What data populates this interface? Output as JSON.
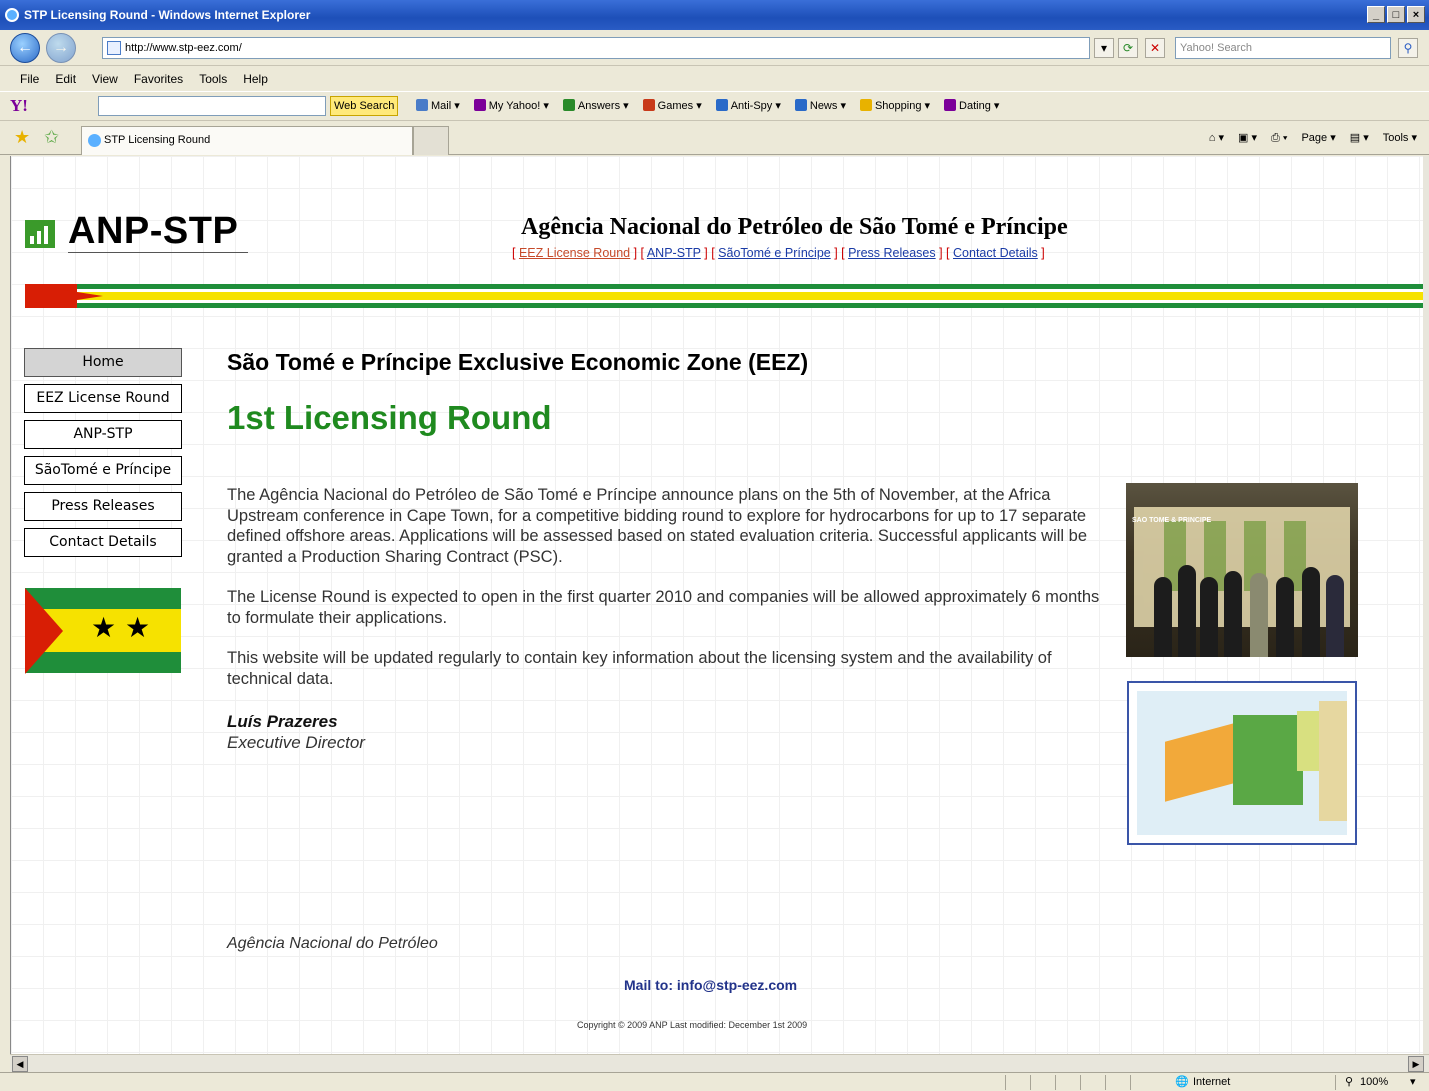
{
  "window": {
    "title": "STP Licensing Round - Windows Internet Explorer",
    "buttons": [
      "_",
      "□",
      "×"
    ]
  },
  "address_bar": {
    "url": "http://www.stp-eez.com/",
    "search_placeholder": "Yahoo! Search"
  },
  "menu": [
    "File",
    "Edit",
    "View",
    "Favorites",
    "Tools",
    "Help"
  ],
  "yahoo_toolbar": {
    "logo": "Y!",
    "web_search": "Web Search",
    "items": [
      "Mail",
      "My Yahoo!",
      "Answers",
      "Games",
      "Anti-Spy",
      "News",
      "Shopping",
      "Dating"
    ],
    "item_colors": [
      "#4a7cc8",
      "#7b0099",
      "#2a8a2a",
      "#c83a1a",
      "#2a6ac8",
      "#2a6ac8",
      "#e8b200",
      "#7b0099"
    ]
  },
  "tab": {
    "label": "STP Licensing Round"
  },
  "command_bar": [
    "Page",
    "Tools"
  ],
  "site": {
    "logo_text": "ANP-STP",
    "agency_title": "Agência Nacional do Petróleo de São Tomé e Príncipe",
    "top_links": [
      "EEZ License Round",
      "ANP-STP",
      "SãoTomé e Príncipe",
      "Press Releases",
      "Contact Details"
    ],
    "nav": [
      "Home",
      "EEZ License Round",
      "ANP-STP",
      "SãoTomé e Príncipe",
      "Press Releases",
      "Contact Details"
    ],
    "heading": "São Tomé e Príncipe Exclusive Economic Zone (EEZ)",
    "subheading": "1st Licensing Round",
    "paragraphs": [
      "The Agência Nacional do Petróleo de São Tomé e Príncipe announce plans on the 5th of November, at the Africa Upstream conference in Cape Town, for a competitive bidding round to explore for hydrocarbons for up to 17 separate defined offshore areas.  Applications will be assessed based on stated evaluation criteria. Successful applicants will be granted a Production Sharing Contract (PSC).",
      "The License Round is expected to open in the first quarter 2010 and companies will be allowed approximately 6 months to formulate their applications.",
      "This website will be updated regularly to contain key information about the licensing system and the availability of technical data."
    ],
    "signature_name": "Luís Prazeres",
    "signature_title": "Executive Director",
    "photo_sign": "SAO TOME & PRINCIPE",
    "footer_agency": "Agência Nacional do Petróleo",
    "footer_mail": "Mail to:  info@stp-eez.com",
    "footer_copyright": "Copyright © 2009 ANP    Last modified: December 1st 2009",
    "colors": {
      "green_heading": "#1f8a1f",
      "link_blue": "#1a3ba6",
      "flag_red": "#d81e05",
      "flag_green": "#1f8e3a",
      "flag_yellow": "#f6e200"
    }
  },
  "status_bar": {
    "zone": "Internet",
    "zoom": "100%"
  }
}
